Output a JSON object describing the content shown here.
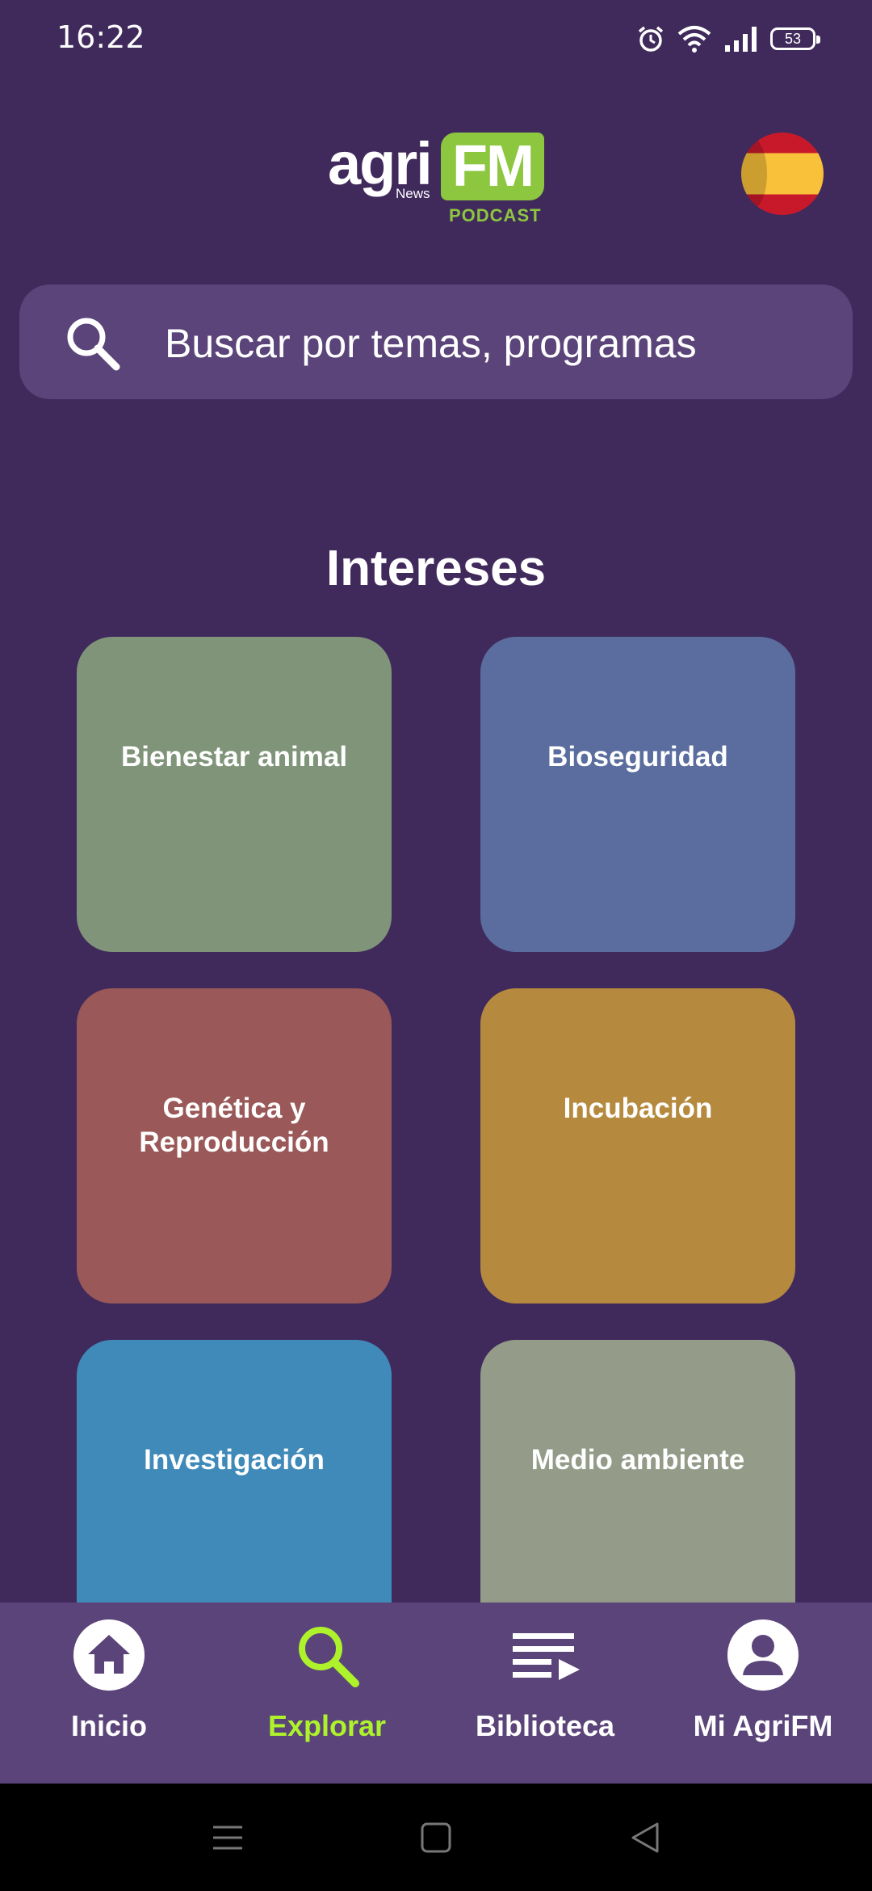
{
  "status_bar": {
    "time": "16:22",
    "battery": "53",
    "icons": [
      "alarm-icon",
      "wifi-icon",
      "signal-icon",
      "battery-icon"
    ]
  },
  "header": {
    "logo": {
      "agri": "agri",
      "news": "News",
      "fm": "FM",
      "podcast": "PODCAST"
    },
    "language_flag": "spain-flag-icon"
  },
  "search": {
    "placeholder": "Buscar por temas, programas"
  },
  "interests": {
    "title": "Intereses",
    "cards": [
      {
        "label": "Bienestar animal",
        "color": "#7f9478"
      },
      {
        "label": "Bioseguridad",
        "color": "#5a6d9e"
      },
      {
        "label": "Genética y Reproducción",
        "color": "#9b5858"
      },
      {
        "label": "Incubación",
        "color": "#b68a3e"
      },
      {
        "label": "Investigación",
        "color": "#3f8ab9"
      },
      {
        "label": "Medio ambiente",
        "color": "#949c89"
      }
    ]
  },
  "bottom_nav": {
    "items": [
      {
        "label": "Inicio",
        "icon": "home-icon",
        "active": false
      },
      {
        "label": "Explorar",
        "icon": "search-icon",
        "active": true
      },
      {
        "label": "Biblioteca",
        "icon": "playlist-icon",
        "active": false
      },
      {
        "label": "Mi AgriFM",
        "icon": "profile-icon",
        "active": false
      }
    ],
    "active_color": "#adf22b"
  },
  "colors": {
    "background": "#402a5c",
    "surface": "#5b4479",
    "brand_green": "#8dc63f"
  }
}
